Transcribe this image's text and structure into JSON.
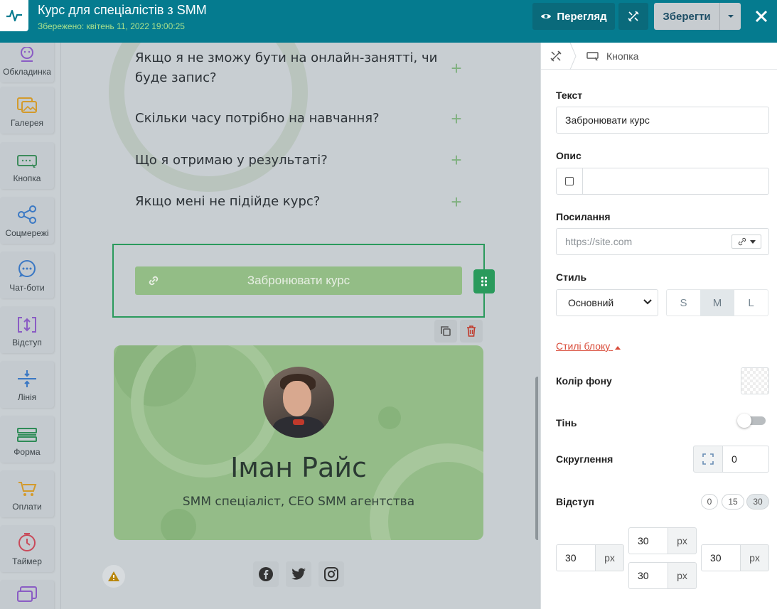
{
  "header": {
    "title": "Курс для спеціалістів з SMM",
    "saved": "Збережено: квітень 11, 2022 19:00:25",
    "preview_label": "Перегляд",
    "save_label": "Зберегти"
  },
  "sidebar": {
    "items": [
      {
        "label": "Обкладинка",
        "icon": "cover-icon"
      },
      {
        "label": "Галерея",
        "icon": "gallery-icon"
      },
      {
        "label": "Кнопка",
        "icon": "button-icon"
      },
      {
        "label": "Соцмережі",
        "icon": "share-icon"
      },
      {
        "label": "Чат-боти",
        "icon": "chat-icon"
      },
      {
        "label": "Відступ",
        "icon": "spacing-icon"
      },
      {
        "label": "Лінія",
        "icon": "line-icon"
      },
      {
        "label": "Форма",
        "icon": "form-icon"
      },
      {
        "label": "Оплати",
        "icon": "cart-icon"
      },
      {
        "label": "Таймер",
        "icon": "timer-icon"
      }
    ]
  },
  "canvas": {
    "faq": [
      {
        "q": "Якщо я не зможу бути на онлайн-заняттi, чи буде запис?"
      },
      {
        "q": "Скільки часу потрібно на навчання?"
      },
      {
        "q": "Що я отримаю у результатi?"
      },
      {
        "q": "Якщо менi не пiдiйде курс?"
      }
    ],
    "cta_label": "Забронювати курс",
    "profile": {
      "name": "Iман Райс",
      "role": "SMM спецiалiст, CEO SMM агентства"
    }
  },
  "panel": {
    "breadcrumb": "Кнопка",
    "text_label": "Текст",
    "text_value": "Забронювати курс",
    "desc_label": "Опис",
    "link_label": "Посилання",
    "link_placeholder": "https://site.com",
    "style_label": "Стиль",
    "style_value": "Основний",
    "sizes": [
      "S",
      "M",
      "L"
    ],
    "active_size": "M",
    "block_styles_link": "Стилі блоку",
    "bg_color_label": "Колір фону",
    "shadow_label": "Тінь",
    "radius_label": "Скруглення",
    "radius_value": "0",
    "padding_label": "Відступ",
    "padding_presets": [
      "0",
      "15",
      "30"
    ],
    "active_preset": "30",
    "padding": {
      "top": "30",
      "left": "30",
      "right": "30",
      "bottom": "30",
      "unit": "px"
    }
  },
  "colors": {
    "topbar": "#057b8f",
    "accent_green": "#2a9a5c",
    "link_red": "#d94c3a"
  }
}
